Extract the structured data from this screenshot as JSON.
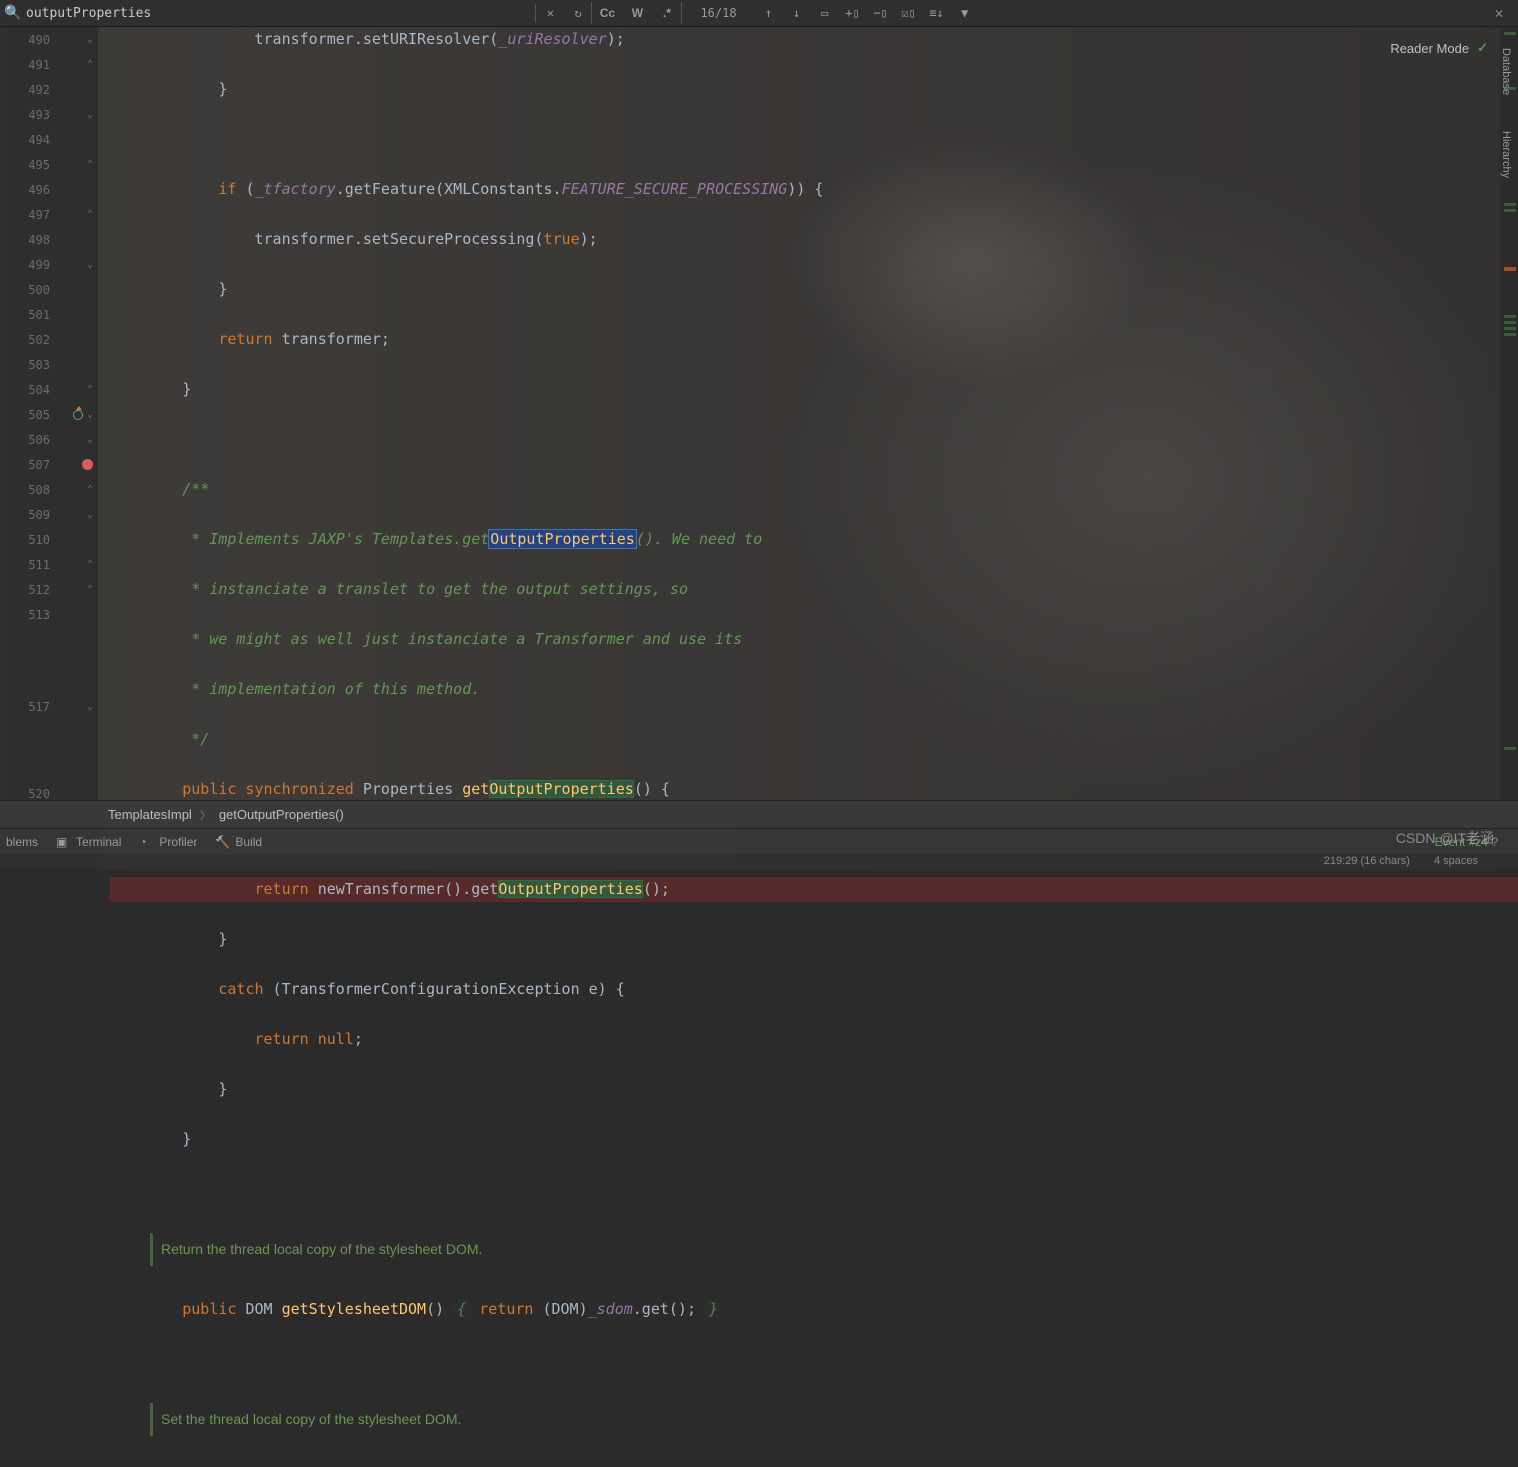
{
  "find": {
    "query": "outputProperties",
    "count": "16/18",
    "buttons": {
      "cc": "Cc",
      "word": "W",
      "regex": ".*",
      "prev": "↑",
      "next": "↓",
      "select_all": "▭",
      "add_selection": "+▯",
      "remove_selection": "−▯",
      "select_occurrences": "☑▯",
      "sort": "≡↓",
      "filter": "▼"
    }
  },
  "reader_mode": {
    "label": "Reader Mode"
  },
  "right_tabs": {
    "database": "Database",
    "hierarchy": "Hierarchy"
  },
  "gutter_lines": [
    "490",
    "491",
    "492",
    "493",
    "494",
    "495",
    "496",
    "497",
    "498",
    "499",
    "500",
    "501",
    "502",
    "503",
    "504",
    "505",
    "506",
    "507",
    "508",
    "509",
    "510",
    "511",
    "512",
    "513",
    "",
    "517",
    "520"
  ],
  "breakpoint_line": "507",
  "override_line": "505",
  "code": {
    "l490": "                transformer.setURIResolver(_uriResolver);",
    "l491": "            }",
    "l492": "",
    "l493": "            if (_tfactory.getFeature(XMLConstants.FEATURE_SECURE_PROCESSING)) {",
    "l494": "                transformer.setSecureProcessing(true);",
    "l495": "            }",
    "l496": "            return transformer;",
    "l497": "        }",
    "l498": "",
    "l499": "        /**",
    "l500": "         * Implements JAXP's Templates.getOutputProperties(). We need to",
    "l501": "         * instanciate a translet to get the output settings, so",
    "l502": "         * we might as well just instanciate a Transformer and use its",
    "l503": "         * implementation of this method.",
    "l504": "         */",
    "l505": "        public synchronized Properties getOutputProperties() {",
    "l506": "            try {",
    "l507": "                return newTransformer().getOutputProperties();",
    "l508": "            }",
    "l509": "            catch (TransformerConfigurationException e) {",
    "l510": "                return null;",
    "l511": "            }",
    "l512": "        }",
    "l513": "",
    "doc2": "Return the thread local copy of the stylesheet DOM.",
    "l517": "        public DOM getStylesheetDOM() { return (DOM)_sdom.get(); }",
    "l520": "",
    "doc3": "Set the thread local copy of the stylesheet DOM."
  },
  "breadcrumbs": [
    "TemplatesImpl",
    "getOutputProperties()"
  ],
  "tool_tabs": {
    "problems": "blems",
    "terminal": "Terminal",
    "profiler": "Profiler",
    "build": "Build"
  },
  "status": {
    "pos": "219:29 (16 chars)",
    "indent": "4 spaces",
    "event": "Event #z4 ?"
  },
  "watermark": "CSDN @IT老涵"
}
